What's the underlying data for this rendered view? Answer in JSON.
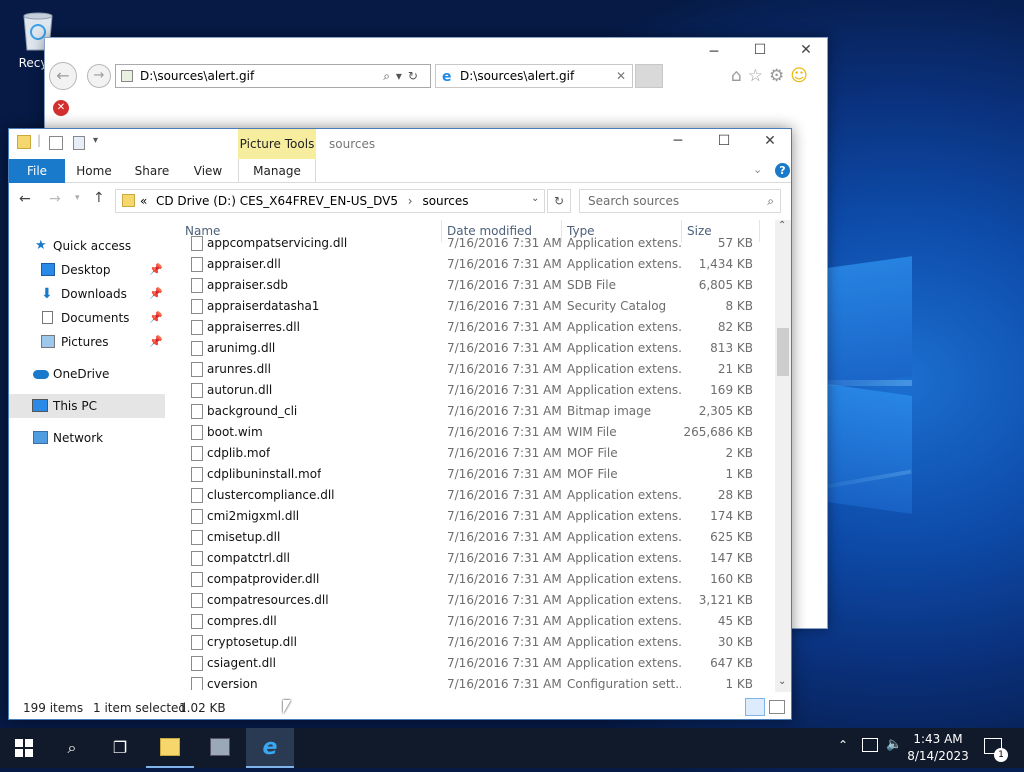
{
  "desktop": {
    "recycle_label": "Recycl"
  },
  "ie": {
    "address": "D:\\sources\\alert.gif",
    "tab_title": "D:\\sources\\alert.gif",
    "error_icon": "error-icon"
  },
  "explorer": {
    "title": "sources",
    "contextual_group": "Picture Tools",
    "tabs": {
      "file": "File",
      "home": "Home",
      "share": "Share",
      "view": "View",
      "manage": "Manage"
    },
    "breadcrumb": {
      "prefix": "«",
      "drive": "CD Drive (D:) CES_X64FREV_EN-US_DV5",
      "sep": "›",
      "folder": "sources"
    },
    "search_placeholder": "Search sources",
    "nav": {
      "quick_access": "Quick access",
      "desktop": "Desktop",
      "downloads": "Downloads",
      "documents": "Documents",
      "pictures": "Pictures",
      "onedrive": "OneDrive",
      "this_pc": "This PC",
      "network": "Network"
    },
    "columns": {
      "name": "Name",
      "date": "Date modified",
      "type": "Type",
      "size": "Size"
    },
    "files": [
      {
        "name": "appcompatservicing.dll",
        "date": "7/16/2016 7:31 AM",
        "type": "Application extens...",
        "size": "57 KB"
      },
      {
        "name": "appraiser.dll",
        "date": "7/16/2016 7:31 AM",
        "type": "Application extens...",
        "size": "1,434 KB"
      },
      {
        "name": "appraiser.sdb",
        "date": "7/16/2016 7:31 AM",
        "type": "SDB File",
        "size": "6,805 KB"
      },
      {
        "name": "appraiserdatasha1",
        "date": "7/16/2016 7:31 AM",
        "type": "Security Catalog",
        "size": "8 KB"
      },
      {
        "name": "appraiserres.dll",
        "date": "7/16/2016 7:31 AM",
        "type": "Application extens...",
        "size": "82 KB"
      },
      {
        "name": "arunimg.dll",
        "date": "7/16/2016 7:31 AM",
        "type": "Application extens...",
        "size": "813 KB"
      },
      {
        "name": "arunres.dll",
        "date": "7/16/2016 7:31 AM",
        "type": "Application extens...",
        "size": "21 KB"
      },
      {
        "name": "autorun.dll",
        "date": "7/16/2016 7:31 AM",
        "type": "Application extens...",
        "size": "169 KB"
      },
      {
        "name": "background_cli",
        "date": "7/16/2016 7:31 AM",
        "type": "Bitmap image",
        "size": "2,305 KB"
      },
      {
        "name": "boot.wim",
        "date": "7/16/2016 7:31 AM",
        "type": "WIM File",
        "size": "265,686 KB"
      },
      {
        "name": "cdplib.mof",
        "date": "7/16/2016 7:31 AM",
        "type": "MOF File",
        "size": "2 KB"
      },
      {
        "name": "cdplibuninstall.mof",
        "date": "7/16/2016 7:31 AM",
        "type": "MOF File",
        "size": "1 KB"
      },
      {
        "name": "clustercompliance.dll",
        "date": "7/16/2016 7:31 AM",
        "type": "Application extens...",
        "size": "28 KB"
      },
      {
        "name": "cmi2migxml.dll",
        "date": "7/16/2016 7:31 AM",
        "type": "Application extens...",
        "size": "174 KB"
      },
      {
        "name": "cmisetup.dll",
        "date": "7/16/2016 7:31 AM",
        "type": "Application extens...",
        "size": "625 KB"
      },
      {
        "name": "compatctrl.dll",
        "date": "7/16/2016 7:31 AM",
        "type": "Application extens...",
        "size": "147 KB"
      },
      {
        "name": "compatprovider.dll",
        "date": "7/16/2016 7:31 AM",
        "type": "Application extens...",
        "size": "160 KB"
      },
      {
        "name": "compatresources.dll",
        "date": "7/16/2016 7:31 AM",
        "type": "Application extens...",
        "size": "3,121 KB"
      },
      {
        "name": "compres.dll",
        "date": "7/16/2016 7:31 AM",
        "type": "Application extens...",
        "size": "45 KB"
      },
      {
        "name": "cryptosetup.dll",
        "date": "7/16/2016 7:31 AM",
        "type": "Application extens...",
        "size": "30 KB"
      },
      {
        "name": "csiagent.dll",
        "date": "7/16/2016 7:31 AM",
        "type": "Application extens...",
        "size": "647 KB"
      },
      {
        "name": "cversion",
        "date": "7/16/2016 7:31 AM",
        "type": "Configuration sett...",
        "size": "1 KB"
      }
    ],
    "status": {
      "count": "199 items",
      "selected": "1 item selected",
      "selected_size": "1.02 KB"
    }
  },
  "taskbar": {
    "time": "1:43 AM",
    "date": "8/14/2023",
    "notification_count": "1"
  }
}
